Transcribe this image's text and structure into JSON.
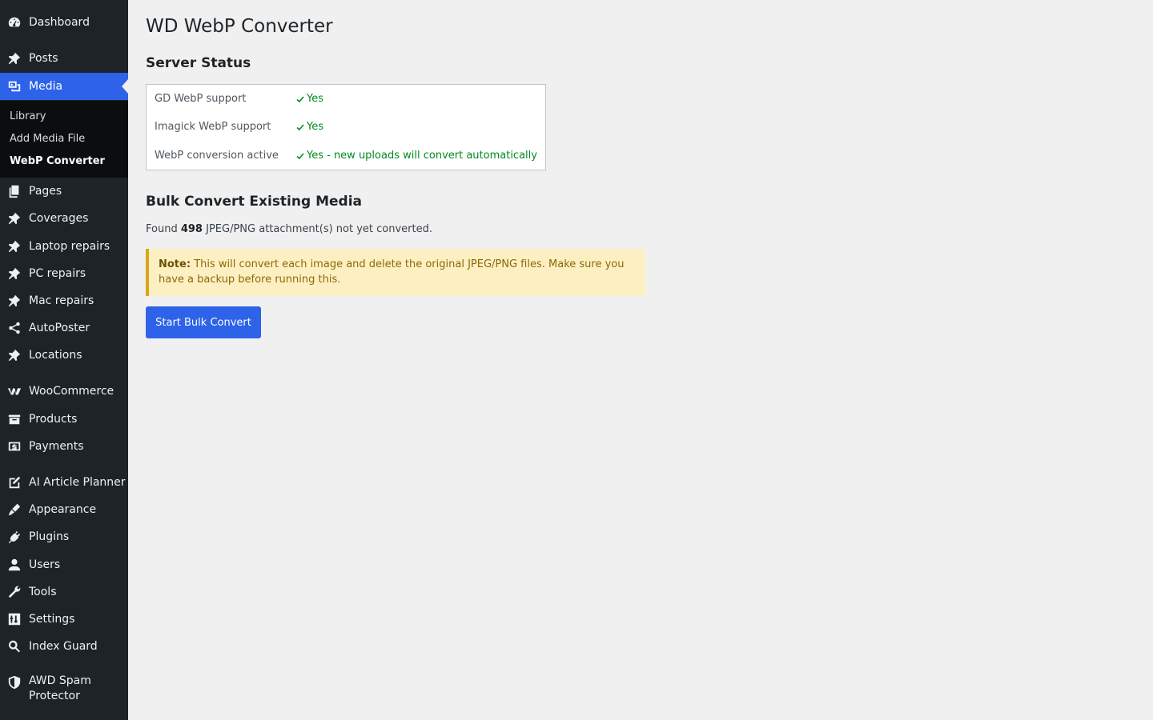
{
  "sidebar": {
    "items": [
      {
        "label": "Dashboard",
        "icon": "dashboard-icon"
      },
      {
        "label": "Posts",
        "icon": "pin-icon"
      },
      {
        "label": "Media",
        "icon": "media-icon",
        "current": true
      },
      {
        "label": "Pages",
        "icon": "pages-icon"
      },
      {
        "label": "Coverages",
        "icon": "pin-icon"
      },
      {
        "label": "Laptop repairs",
        "icon": "pin-icon"
      },
      {
        "label": "PC repairs",
        "icon": "pin-icon"
      },
      {
        "label": "Mac repairs",
        "icon": "pin-icon"
      },
      {
        "label": "AutoPoster",
        "icon": "share-icon"
      },
      {
        "label": "Locations",
        "icon": "pin-icon"
      },
      {
        "label": "WooCommerce",
        "icon": "woocommerce-icon"
      },
      {
        "label": "Products",
        "icon": "archive-icon"
      },
      {
        "label": "Payments",
        "icon": "dollar-icon"
      },
      {
        "label": "AI Article Planner",
        "icon": "edit-icon"
      },
      {
        "label": "Appearance",
        "icon": "brush-icon"
      },
      {
        "label": "Plugins",
        "icon": "plug-icon"
      },
      {
        "label": "Users",
        "icon": "user-icon"
      },
      {
        "label": "Tools",
        "icon": "wrench-icon"
      },
      {
        "label": "Settings",
        "icon": "settings-icon"
      },
      {
        "label": "Index Guard",
        "icon": "search-icon"
      },
      {
        "label": "AWD Spam Protector",
        "icon": "shield-icon"
      }
    ],
    "submenu": [
      {
        "label": "Library"
      },
      {
        "label": "Add Media File"
      },
      {
        "label": "WebP Converter",
        "active": true
      }
    ]
  },
  "page": {
    "title": "WD WebP Converter",
    "server_status_heading": "Server Status",
    "status_rows": [
      {
        "label": "GD WebP support",
        "value": "Yes"
      },
      {
        "label": "Imagick WebP support",
        "value": "Yes"
      },
      {
        "label": "WebP conversion active",
        "value": "Yes - new uploads will convert automatically"
      }
    ],
    "bulk_heading": "Bulk Convert Existing Media",
    "found_prefix": "Found",
    "found_count": "498",
    "found_suffix": "JPEG/PNG attachment(s) not yet converted.",
    "note_label": "Note:",
    "note_text": "This will convert each image and delete the original JPEG/PNG files. Make sure you have a backup before running this.",
    "bulk_button_label": "Start Bulk Convert"
  },
  "colors": {
    "sidebar_bg": "#1d2327",
    "accent": "#2d62e9",
    "success": "#008a20",
    "notice_bg": "#fcf0c3",
    "notice_border": "#dba617"
  }
}
